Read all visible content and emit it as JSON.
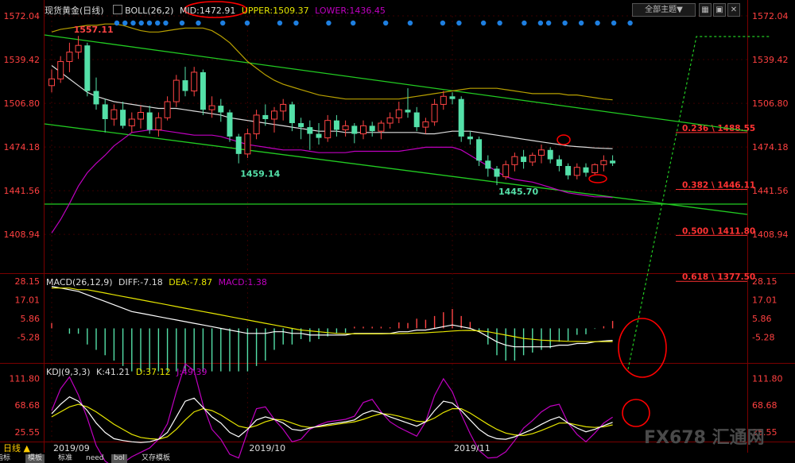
{
  "header": {
    "title": "现货黄金(日线)",
    "boll": "BOLL(26,2)",
    "mid": "MID:1472.91",
    "upper": "UPPER:1509.37",
    "lower": "LOWER:1436.45",
    "theme_button": "全部主题▼",
    "macd": "MACD(26,12,9)",
    "diff": "DIFF:-7.18",
    "dea": "DEA:-7.87",
    "macd_val": "MACD:1.38",
    "kdj": "KDJ(9,3,3)",
    "k": "K:41.21",
    "d": "D:37.12",
    "j": "J:49.39"
  },
  "footer": {
    "period": "日线 ▲",
    "tabs": [
      "指标",
      "模板",
      "标准",
      "need",
      "bol",
      "又存模板"
    ]
  },
  "watermark": "FX678 汇通网",
  "colors": {
    "up": "#ff4444",
    "down": "#54e0a8",
    "mid": "#dddddd",
    "boll_band": "#c000c0",
    "upper_band": "#b8a000",
    "channel": "#22cc22",
    "fib": "#ff3333",
    "dea": "#e6e600",
    "kdj_d": "#e6e600",
    "kdj_j": "#c000c0",
    "dots": "#1e7fe0",
    "highlight": "#ff0000"
  },
  "chart_data": [
    {
      "type": "candlestick",
      "title": "现货黄金(日线)",
      "y_ticks": [
        "1572.04",
        "1539.42",
        "1506.80",
        "1474.18",
        "1441.56",
        "1408.94"
      ],
      "ylim": [
        1380,
        1572.04
      ],
      "x_labels": [
        {
          "label": "2019/09",
          "index": 0
        },
        {
          "label": "2019/10",
          "index": 22
        },
        {
          "label": "2019/11",
          "index": 45
        }
      ],
      "candles": [
        [
          1520,
          1532,
          1515,
          1525
        ],
        [
          1525,
          1542,
          1522,
          1538
        ],
        [
          1538,
          1552,
          1530,
          1545
        ],
        [
          1545,
          1557.11,
          1540,
          1550
        ],
        [
          1550,
          1552,
          1512,
          1516
        ],
        [
          1516,
          1526,
          1502,
          1506
        ],
        [
          1506,
          1510,
          1485,
          1495
        ],
        [
          1495,
          1506,
          1490,
          1502
        ],
        [
          1502,
          1508,
          1488,
          1490
        ],
        [
          1490,
          1500,
          1485,
          1495
        ],
        [
          1495,
          1505,
          1488,
          1500
        ],
        [
          1500,
          1505,
          1484,
          1487
        ],
        [
          1487,
          1500,
          1482,
          1496
        ],
        [
          1496,
          1512,
          1494,
          1508
        ],
        [
          1508,
          1528,
          1504,
          1524
        ],
        [
          1524,
          1534,
          1512,
          1516
        ],
        [
          1516,
          1534,
          1512,
          1530
        ],
        [
          1530,
          1532,
          1498,
          1502
        ],
        [
          1502,
          1512,
          1496,
          1505
        ],
        [
          1505,
          1510,
          1493,
          1500
        ],
        [
          1500,
          1502,
          1478,
          1482
        ],
        [
          1482,
          1484,
          1462,
          1469
        ],
        [
          1469,
          1488,
          1466,
          1484
        ],
        [
          1484,
          1502,
          1480,
          1498
        ],
        [
          1498,
          1506,
          1490,
          1495
        ],
        [
          1495,
          1504,
          1485,
          1501
        ],
        [
          1501,
          1510,
          1494,
          1506
        ],
        [
          1506,
          1508,
          1486,
          1492
        ],
        [
          1492,
          1496,
          1480,
          1489
        ],
        [
          1489,
          1494,
          1472,
          1484
        ],
        [
          1484,
          1492,
          1476,
          1481
        ],
        [
          1481,
          1498,
          1478,
          1494
        ],
        [
          1494,
          1498,
          1482,
          1487
        ],
        [
          1487,
          1494,
          1482,
          1490
        ],
        [
          1490,
          1492,
          1477,
          1484
        ],
        [
          1484,
          1494,
          1480,
          1490
        ],
        [
          1490,
          1493,
          1482,
          1486
        ],
        [
          1486,
          1494,
          1480,
          1492
        ],
        [
          1492,
          1500,
          1488,
          1496
        ],
        [
          1496,
          1508,
          1492,
          1502
        ],
        [
          1502,
          1518,
          1496,
          1500
        ],
        [
          1500,
          1504,
          1486,
          1489
        ],
        [
          1489,
          1496,
          1484,
          1493
        ],
        [
          1493,
          1510,
          1490,
          1506
        ],
        [
          1506,
          1516,
          1502,
          1512
        ],
        [
          1512,
          1515,
          1506,
          1510
        ],
        [
          1510,
          1512,
          1478,
          1482
        ],
        [
          1482,
          1486,
          1476,
          1480
        ],
        [
          1480,
          1482,
          1460,
          1464
        ],
        [
          1464,
          1468,
          1452,
          1458
        ],
        [
          1458,
          1460,
          1445.7,
          1452
        ],
        [
          1452,
          1464,
          1450,
          1461
        ],
        [
          1461,
          1470,
          1456,
          1467
        ],
        [
          1467,
          1472,
          1458,
          1463
        ],
        [
          1463,
          1470,
          1460,
          1468
        ],
        [
          1468,
          1476,
          1462,
          1472
        ],
        [
          1472,
          1474,
          1462,
          1465
        ],
        [
          1465,
          1468,
          1456,
          1460
        ],
        [
          1460,
          1462,
          1450,
          1453
        ],
        [
          1453,
          1462,
          1450,
          1459
        ],
        [
          1459,
          1462,
          1452,
          1455
        ],
        [
          1455,
          1462,
          1453,
          1461
        ],
        [
          1461,
          1468,
          1456,
          1464
        ],
        [
          1464,
          1468,
          1460,
          1462
        ]
      ],
      "mid": [
        1535,
        1530,
        1525,
        1520,
        1515,
        1512,
        1510,
        1508,
        1507,
        1506,
        1505,
        1504,
        1503,
        1503,
        1503,
        1502,
        1501,
        1500,
        1499,
        1498,
        1496,
        1495,
        1494,
        1493,
        1492,
        1491,
        1490,
        1489,
        1488,
        1487,
        1486,
        1486,
        1486,
        1485,
        1485,
        1485,
        1485,
        1485,
        1485,
        1485,
        1485,
        1485,
        1484,
        1484,
        1485,
        1486,
        1486,
        1486,
        1485,
        1484,
        1483,
        1482,
        1481,
        1480,
        1479,
        1478,
        1477,
        1476,
        1475,
        1474.5,
        1474,
        1473.5,
        1473.2,
        1472.91
      ],
      "upper": [
        1560,
        1562,
        1563,
        1564,
        1565,
        1565,
        1566,
        1566,
        1565,
        1563,
        1561,
        1560,
        1560,
        1561,
        1562,
        1563,
        1563,
        1563,
        1561,
        1557,
        1552,
        1545,
        1538,
        1533,
        1528,
        1524,
        1521,
        1519,
        1517,
        1515,
        1513,
        1512,
        1511,
        1510,
        1510,
        1510,
        1510,
        1510,
        1510,
        1510,
        1511,
        1512,
        1513,
        1514,
        1515,
        1516,
        1517,
        1518,
        1518,
        1518,
        1518,
        1517,
        1516,
        1515,
        1514,
        1514,
        1514,
        1514,
        1513,
        1513,
        1512,
        1511,
        1510,
        1509.37
      ],
      "lower": [
        1410,
        1420,
        1432,
        1445,
        1455,
        1462,
        1468,
        1475,
        1480,
        1485,
        1486,
        1487,
        1487,
        1486,
        1485,
        1484,
        1483,
        1483,
        1483,
        1482,
        1480,
        1478,
        1476,
        1475,
        1474,
        1473,
        1472,
        1472,
        1472,
        1471,
        1470,
        1470,
        1470,
        1470,
        1471,
        1471,
        1471,
        1471,
        1471,
        1471,
        1472,
        1473,
        1474,
        1474,
        1474,
        1474,
        1472,
        1468,
        1464,
        1460,
        1456,
        1452,
        1450,
        1449,
        1448,
        1446,
        1444,
        1442,
        1440,
        1439,
        1438,
        1437,
        1437,
        1436.45
      ],
      "annotations": [
        {
          "text": "1557.11",
          "index": 3,
          "price": 1557.11
        },
        {
          "text": "1459.14",
          "index": 21,
          "price": 1459.14
        },
        {
          "text": "1445.70",
          "index": 50,
          "price": 1445.7
        }
      ],
      "fib_levels": [
        {
          "label": "0.236",
          "price": "1488.55"
        },
        {
          "label": "0.382",
          "price": "1446.11"
        },
        {
          "label": "0.500",
          "price": "1411.80"
        },
        {
          "label": "0.618",
          "price": "1377.50"
        }
      ]
    },
    {
      "type": "bar",
      "title": "MACD(26,12,9)",
      "y_ticks": [
        "28.15",
        "17.01",
        "5.86",
        "-5.28"
      ],
      "ylim": [
        -22,
        30
      ],
      "diff": [
        25,
        24,
        23,
        22,
        20,
        18,
        16,
        14,
        12,
        10,
        9,
        8,
        7,
        6,
        5,
        4,
        3,
        2,
        1,
        0,
        -1,
        -2,
        -3,
        -3,
        -3,
        -2,
        -2,
        -3,
        -3,
        -4,
        -4,
        -4,
        -4,
        -4,
        -3,
        -3,
        -3,
        -3,
        -3,
        -2,
        -2,
        -1,
        -1,
        0,
        1,
        2,
        1,
        0,
        -2,
        -5,
        -8,
        -10,
        -11,
        -11,
        -11,
        -11,
        -11,
        -10,
        -10,
        -9,
        -9,
        -8,
        -7.5,
        -7.18
      ],
      "dea": [
        24,
        24,
        24,
        23,
        23,
        22,
        21,
        20,
        19,
        18,
        17,
        16,
        15,
        14,
        13,
        12,
        11,
        10,
        9,
        8,
        7,
        6,
        5,
        4,
        3,
        2,
        1,
        0,
        -1,
        -1.5,
        -2,
        -2.5,
        -3,
        -3.2,
        -3.3,
        -3.3,
        -3.3,
        -3.3,
        -3.2,
        -3.1,
        -3,
        -2.8,
        -2.6,
        -2.3,
        -2,
        -1.6,
        -1.3,
        -1.2,
        -1.5,
        -2,
        -3,
        -4,
        -5,
        -6,
        -6.5,
        -7,
        -7.3,
        -7.5,
        -7.7,
        -7.8,
        -7.9,
        -7.9,
        -7.9,
        -7.87
      ],
      "macd": [
        1,
        0,
        -1,
        -1,
        -3,
        -4,
        -5,
        -6,
        -7,
        -8,
        -8,
        -8,
        -8,
        -8,
        -8,
        -8,
        -8,
        -8,
        -8,
        -8,
        -8,
        -8,
        -8,
        -7,
        -6,
        -4,
        -3,
        -3,
        -2,
        -2.5,
        -2,
        -1.5,
        -1,
        -0.8,
        0.3,
        0.3,
        0.3,
        0.3,
        0.2,
        1.1,
        1,
        1.8,
        1.6,
        2.3,
        3,
        3.6,
        2.3,
        1.2,
        -0.5,
        -3,
        -5,
        -6,
        -6,
        -5,
        -4.5,
        -4,
        -3.7,
        -2.5,
        -2.3,
        -1.2,
        -1.1,
        -0.1,
        0.4,
        1.38
      ]
    },
    {
      "type": "line",
      "title": "KDJ(9,3,3)",
      "y_ticks": [
        "111.80",
        "68.68",
        "25.55"
      ],
      "ylim": [
        -10,
        130
      ],
      "k": [
        55,
        70,
        82,
        75,
        60,
        40,
        25,
        15,
        12,
        10,
        9,
        10,
        14,
        25,
        50,
        75,
        80,
        65,
        50,
        40,
        25,
        18,
        30,
        45,
        50,
        46,
        40,
        30,
        28,
        32,
        35,
        38,
        40,
        42,
        45,
        55,
        60,
        56,
        50,
        45,
        40,
        35,
        42,
        60,
        75,
        72,
        60,
        45,
        30,
        20,
        15,
        14,
        18,
        24,
        30,
        38,
        45,
        50,
        40,
        32,
        26,
        30,
        36,
        41.21
      ],
      "d": [
        50,
        58,
        66,
        70,
        66,
        58,
        48,
        38,
        30,
        22,
        17,
        15,
        14,
        18,
        30,
        45,
        58,
        63,
        60,
        53,
        44,
        35,
        32,
        36,
        42,
        46,
        45,
        40,
        35,
        33,
        34,
        36,
        38,
        40,
        42,
        46,
        51,
        55,
        54,
        51,
        47,
        43,
        42,
        48,
        57,
        63,
        63,
        56,
        47,
        38,
        30,
        24,
        21,
        20,
        23,
        28,
        34,
        40,
        40,
        37,
        34,
        33,
        34,
        37.12
      ],
      "j": [
        60,
        95,
        114,
        85,
        48,
        4,
        -21,
        -31,
        -24,
        -14,
        -7,
        0,
        14,
        39,
        90,
        135,
        124,
        69,
        30,
        14,
        -10,
        -16,
        26,
        63,
        66,
        46,
        30,
        10,
        14,
        30,
        37,
        42,
        44,
        46,
        51,
        73,
        78,
        58,
        42,
        33,
        26,
        19,
        42,
        84,
        111,
        90,
        54,
        23,
        -4,
        -16,
        -15,
        -6,
        12,
        32,
        44,
        58,
        67,
        70,
        40,
        22,
        10,
        24,
        40,
        49.39
      ]
    }
  ]
}
